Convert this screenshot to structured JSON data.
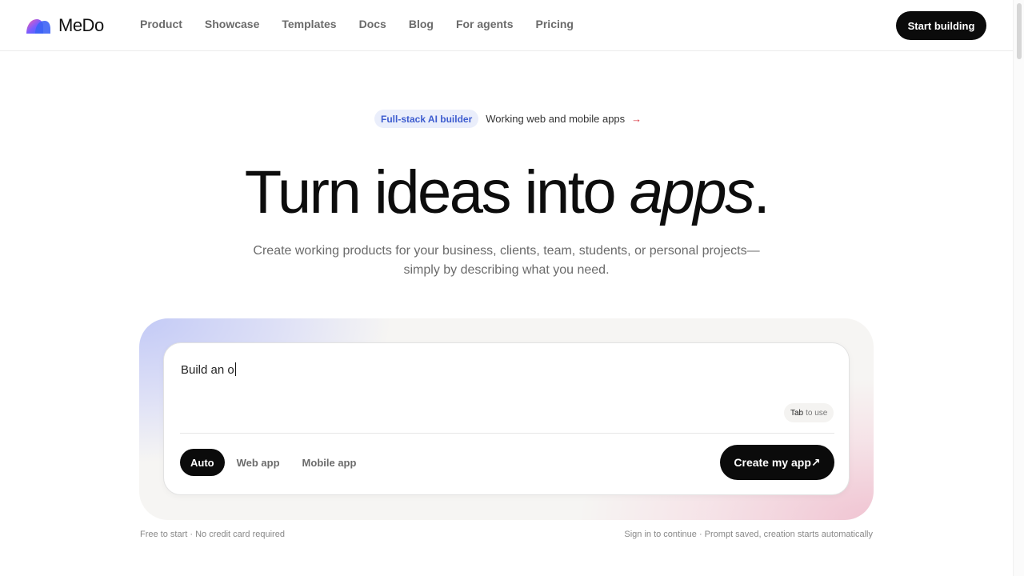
{
  "header": {
    "brand": "MeDo",
    "nav": [
      "Product",
      "Showcase",
      "Templates",
      "Docs",
      "Blog",
      "For agents",
      "Pricing"
    ],
    "cta": "Start building"
  },
  "hero": {
    "badge": "Full-stack AI builder",
    "badge_text": "Working web and mobile apps",
    "badge_arrow": "→",
    "title_main": "Turn ideas into ",
    "title_italic": "apps",
    "title_end": ".",
    "subtitle_line1": "Create working products for your business, clients, team, students, or personal projects—",
    "subtitle_line2": "simply by describing what you need."
  },
  "prompt": {
    "value": "Build an o",
    "tab_key": "Tab",
    "tab_hint": "to use",
    "modes": [
      {
        "label": "Auto",
        "active": true
      },
      {
        "label": "Web app",
        "active": false
      },
      {
        "label": "Mobile app",
        "active": false
      }
    ],
    "submit": "Create my app↗"
  },
  "footnotes": {
    "left": "Free to start · No credit card required",
    "right": "Sign in to continue · Prompt saved, creation starts automatically"
  },
  "colors": {
    "primary": "#0b0b0b",
    "badge_bg": "#eaeefb",
    "badge_text": "#3d5ccf",
    "arrow": "#d9343f"
  }
}
